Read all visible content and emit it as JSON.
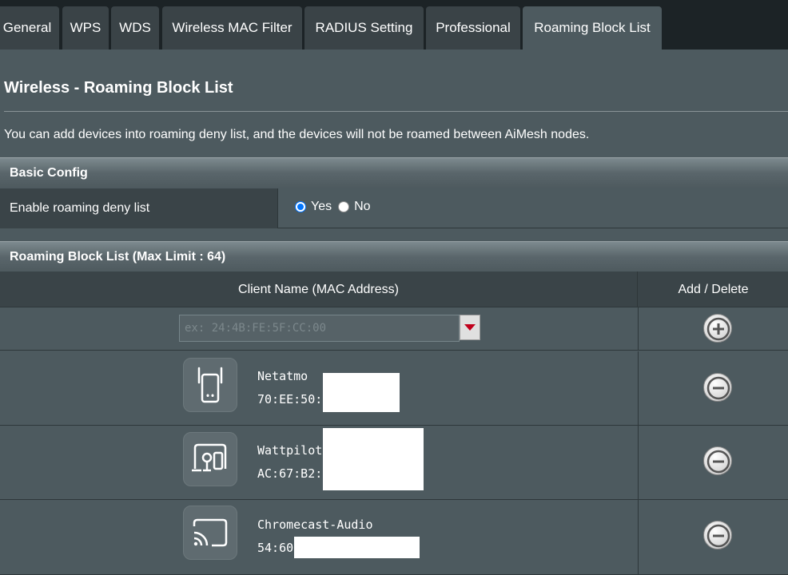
{
  "tabs": [
    {
      "label": "General"
    },
    {
      "label": "WPS"
    },
    {
      "label": "WDS"
    },
    {
      "label": "Wireless MAC Filter"
    },
    {
      "label": "RADIUS Setting"
    },
    {
      "label": "Professional"
    },
    {
      "label": "Roaming Block List",
      "active": true
    }
  ],
  "page": {
    "title": "Wireless - Roaming Block List",
    "description": "You can add devices into roaming deny list, and the devices will not be roamed between AiMesh nodes."
  },
  "basic_config": {
    "header": "Basic Config",
    "enable_label": "Enable roaming deny list",
    "options": [
      {
        "label": "Yes",
        "checked": true
      },
      {
        "label": "No",
        "checked": false
      }
    ]
  },
  "block_list": {
    "header": "Roaming Block List (Max Limit : 64)",
    "col_client": "Client Name (MAC Address)",
    "col_action": "Add / Delete",
    "input_placeholder": "ex: 24:4B:FE:5F:CC:00",
    "clients": [
      {
        "name": "Netatmo",
        "mac": "70:EE:50:",
        "icon": "range-extender-icon"
      },
      {
        "name": "Wattpilot",
        "mac": "AC:67:B2:",
        "icon": "plug-device-icon"
      },
      {
        "name": "Chromecast-Audio",
        "mac": "54:60",
        "icon": "cast-icon"
      }
    ]
  },
  "colors": {
    "background": "#4d5a5f",
    "tab_bar": "#1c2326",
    "radio_accent": "#0075ff",
    "dropdown_arrow": "#c0001c"
  }
}
